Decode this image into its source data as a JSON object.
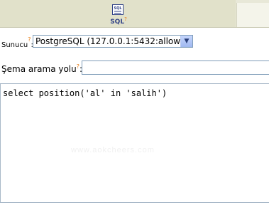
{
  "toolbar": {
    "sql_tab_label": "SQL",
    "help_mark": "?"
  },
  "form": {
    "server_label": "Sunucu",
    "server_help": "?",
    "server_selected": "PostgreSQL (127.0.0.1:5432:allow)",
    "schema_label": "Şema arama yolu",
    "schema_help": "?",
    "schema_value": ""
  },
  "query": {
    "text": "select position('al' in 'salih')"
  },
  "watermark": "www.aokcheers.com",
  "colors": {
    "toolbar_bg": "#e1e1ca",
    "help_mark": "#e87a10",
    "input_border": "#7f9db9"
  }
}
